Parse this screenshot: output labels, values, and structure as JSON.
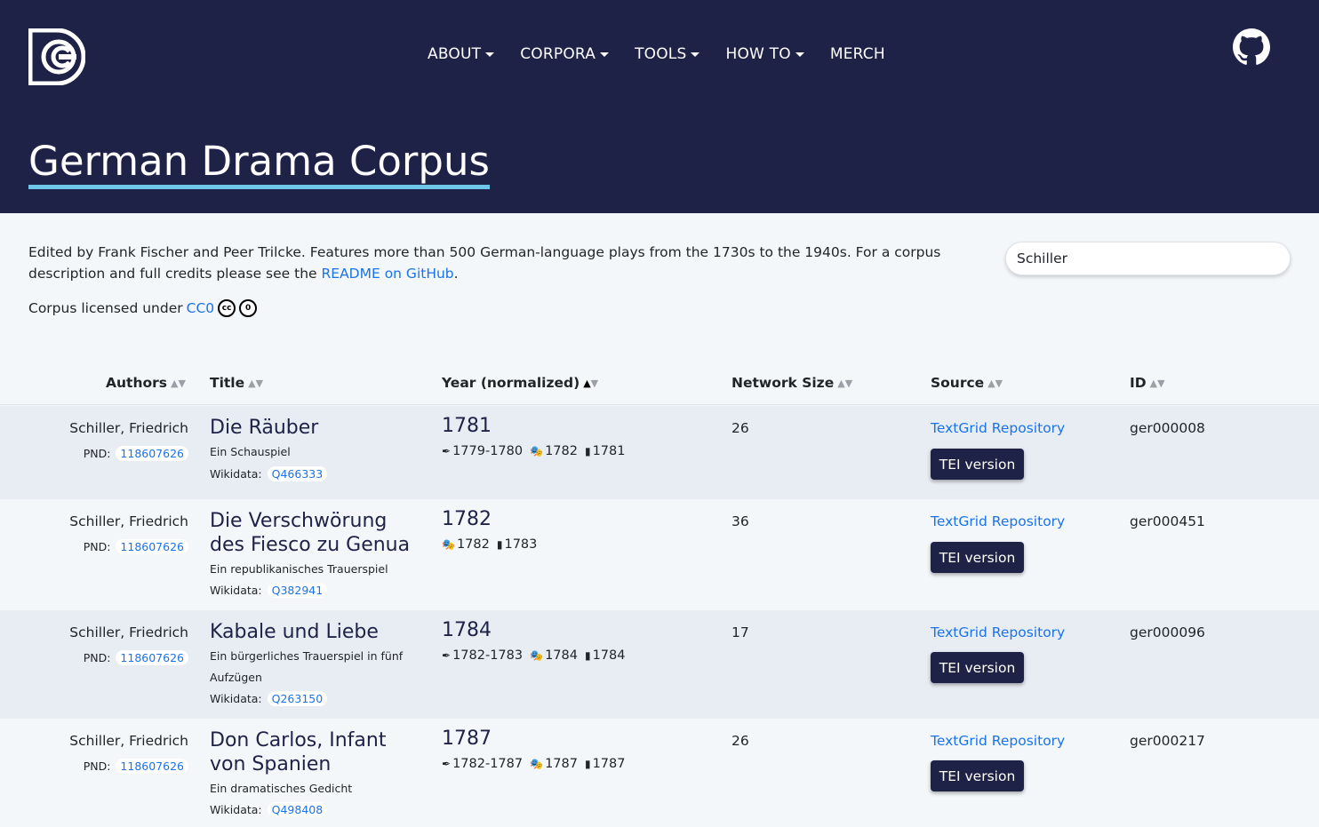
{
  "nav": {
    "items": [
      {
        "label": "ABOUT",
        "dropdown": true
      },
      {
        "label": "CORPORA",
        "dropdown": true
      },
      {
        "label": "TOOLS",
        "dropdown": true
      },
      {
        "label": "HOW TO",
        "dropdown": true
      },
      {
        "label": "MERCH",
        "dropdown": false
      }
    ],
    "logo_icon": "dracor-logo-icon",
    "github_icon": "github-icon"
  },
  "page_title": "German Drama Corpus",
  "intro": {
    "text_before": "Edited by Frank Fischer and Peer Trilcke. Features more than 500 German-language plays from the 1730s to the 1940s. For a corpus description and full credits please see the ",
    "readme_link": "README on GitHub",
    "text_after": ".",
    "license_prefix": "Corpus licensed under",
    "license_link": "CC0",
    "license_icons": [
      "cc-icon",
      "zero-icon"
    ]
  },
  "search": {
    "value": "Schiller",
    "placeholder": ""
  },
  "table": {
    "headers": {
      "authors": "Authors",
      "title": "Title",
      "year": "Year (normalized)",
      "network": "Network Size",
      "source": "Source",
      "id": "ID"
    },
    "sort_active_column": "year",
    "rows": [
      {
        "author": "Schiller, Friedrich",
        "pnd_label": "PND:",
        "pnd": "118607626",
        "title": "Die Räuber",
        "subtitle": "Ein Schauspiel",
        "wikidata_label": "Wikidata:",
        "wikidata": "Q466333",
        "year": "1781",
        "written": "1779-1780",
        "premiered": "1782",
        "printed": "1781",
        "network_size": "26",
        "source": "TextGrid Repository",
        "tei_label": "TEI version",
        "id": "ger000008"
      },
      {
        "author": "Schiller, Friedrich",
        "pnd_label": "PND:",
        "pnd": "118607626",
        "title": "Die Verschwörung des Fiesco zu Genua",
        "subtitle": "Ein republikanisches Trauerspiel",
        "wikidata_label": "Wikidata:",
        "wikidata": "Q382941",
        "year": "1782",
        "written": "",
        "premiered": "1782",
        "printed": "1783",
        "network_size": "36",
        "source": "TextGrid Repository",
        "tei_label": "TEI version",
        "id": "ger000451"
      },
      {
        "author": "Schiller, Friedrich",
        "pnd_label": "PND:",
        "pnd": "118607626",
        "title": "Kabale und Liebe",
        "subtitle": "Ein bürgerliches Trauerspiel in fünf Aufzügen",
        "wikidata_label": "Wikidata:",
        "wikidata": "Q263150",
        "year": "1784",
        "written": "1782-1783",
        "premiered": "1784",
        "printed": "1784",
        "network_size": "17",
        "source": "TextGrid Repository",
        "tei_label": "TEI version",
        "id": "ger000096"
      },
      {
        "author": "Schiller, Friedrich",
        "pnd_label": "PND:",
        "pnd": "118607626",
        "title": "Don Carlos, Infant von Spanien",
        "subtitle": "Ein dramatisches Gedicht",
        "wikidata_label": "Wikidata:",
        "wikidata": "Q498408",
        "year": "1787",
        "written": "1782-1787",
        "premiered": "1787",
        "printed": "1787",
        "network_size": "26",
        "source": "TextGrid Repository",
        "tei_label": "TEI version",
        "id": "ger000217"
      }
    ]
  },
  "colors": {
    "header_bg": "#1f2247",
    "accent_underline": "#6ec6e8",
    "link": "#1a73e8",
    "row_alt": "#e8edf3"
  }
}
